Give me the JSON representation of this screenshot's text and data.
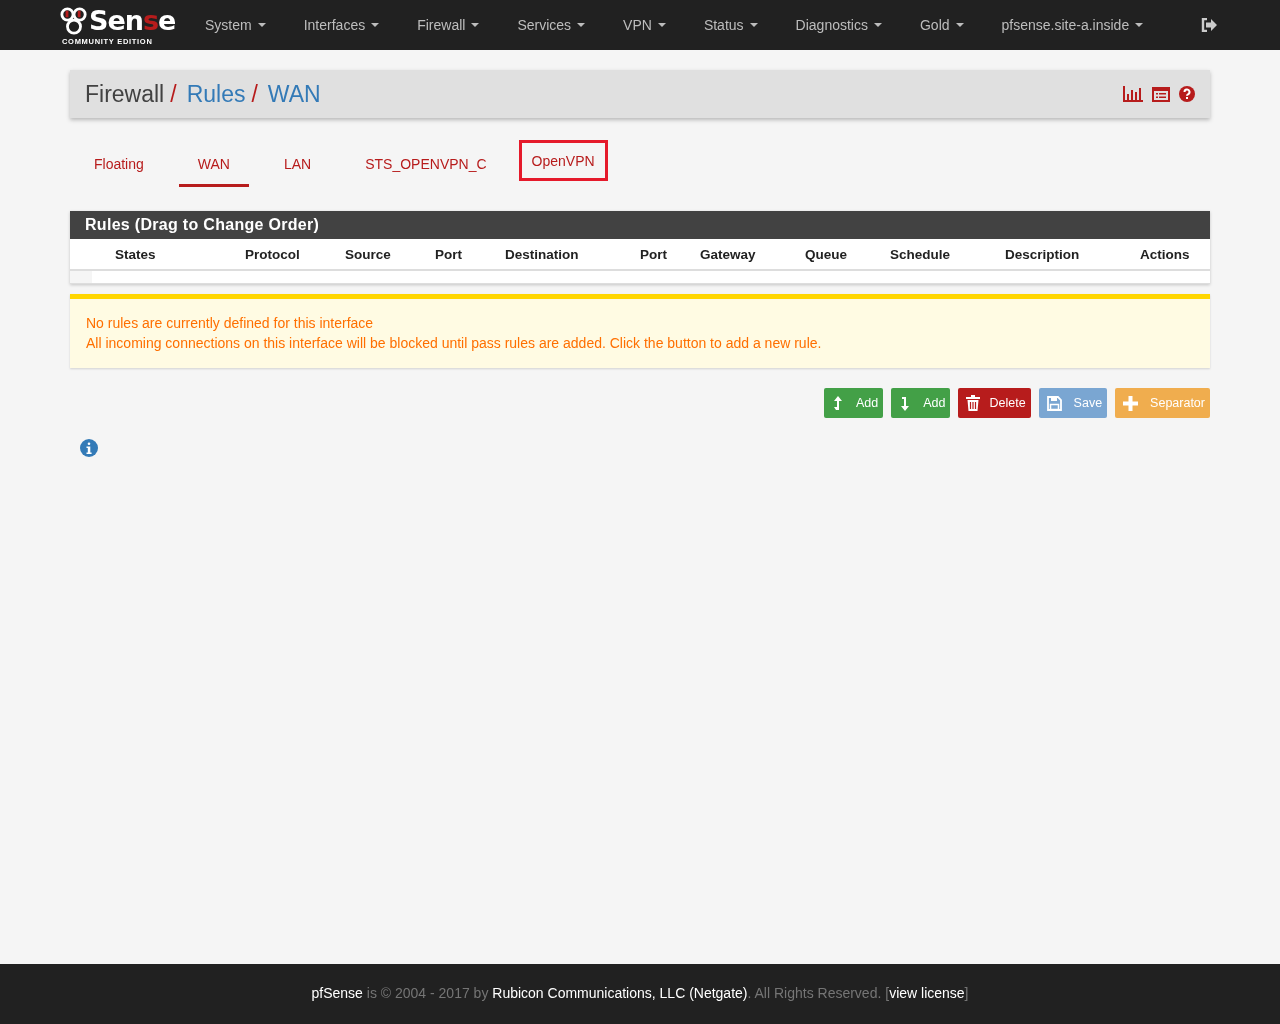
{
  "logo": {
    "start": "Sen",
    "mark": "s",
    "end": "e",
    "edition": "COMMUNITY EDITION"
  },
  "nav": [
    {
      "label": "System"
    },
    {
      "label": "Interfaces"
    },
    {
      "label": "Firewall"
    },
    {
      "label": "Services"
    },
    {
      "label": "VPN"
    },
    {
      "label": "Status"
    },
    {
      "label": "Diagnostics"
    },
    {
      "label": "Gold"
    },
    {
      "label": "pfsense.site-a.inside"
    }
  ],
  "breadcrumb": {
    "separator": "/",
    "items": [
      {
        "label": "Firewall",
        "link": false
      },
      {
        "label": "Rules",
        "link": true
      },
      {
        "label": "WAN",
        "link": true
      }
    ]
  },
  "tabs": [
    {
      "label": "Floating",
      "selected": false,
      "highlighted": false
    },
    {
      "label": "WAN",
      "selected": true,
      "highlighted": false
    },
    {
      "label": "LAN",
      "selected": false,
      "highlighted": false
    },
    {
      "label": "STS_OPENVPN_C",
      "selected": false,
      "highlighted": false
    },
    {
      "label": "OpenVPN",
      "selected": false,
      "highlighted": true
    }
  ],
  "rules_panel": {
    "title": "Rules (Drag to Change Order)",
    "columns": [
      "States",
      "Protocol",
      "Source",
      "Port",
      "Destination",
      "Port",
      "Gateway",
      "Queue",
      "Schedule",
      "Description",
      "Actions"
    ]
  },
  "alert": {
    "lines": [
      "No rules are currently defined for this interface",
      "All incoming connections on this interface will be blocked until pass rules are added. Click the button to add a new rule."
    ]
  },
  "buttons": [
    {
      "kind": "add_top",
      "label": "Add"
    },
    {
      "kind": "add_bottom",
      "label": "Add"
    },
    {
      "kind": "delete",
      "label": "Delete"
    },
    {
      "kind": "save",
      "label": "Save"
    },
    {
      "kind": "separator",
      "label": "Separator"
    }
  ],
  "footer": {
    "before": "**pfSense** is © 2004 - 2017 by **Rubicon Communications, LLC (Netgate)**. All Rights Reserved. [",
    "link": "view license",
    "after": "]"
  }
}
